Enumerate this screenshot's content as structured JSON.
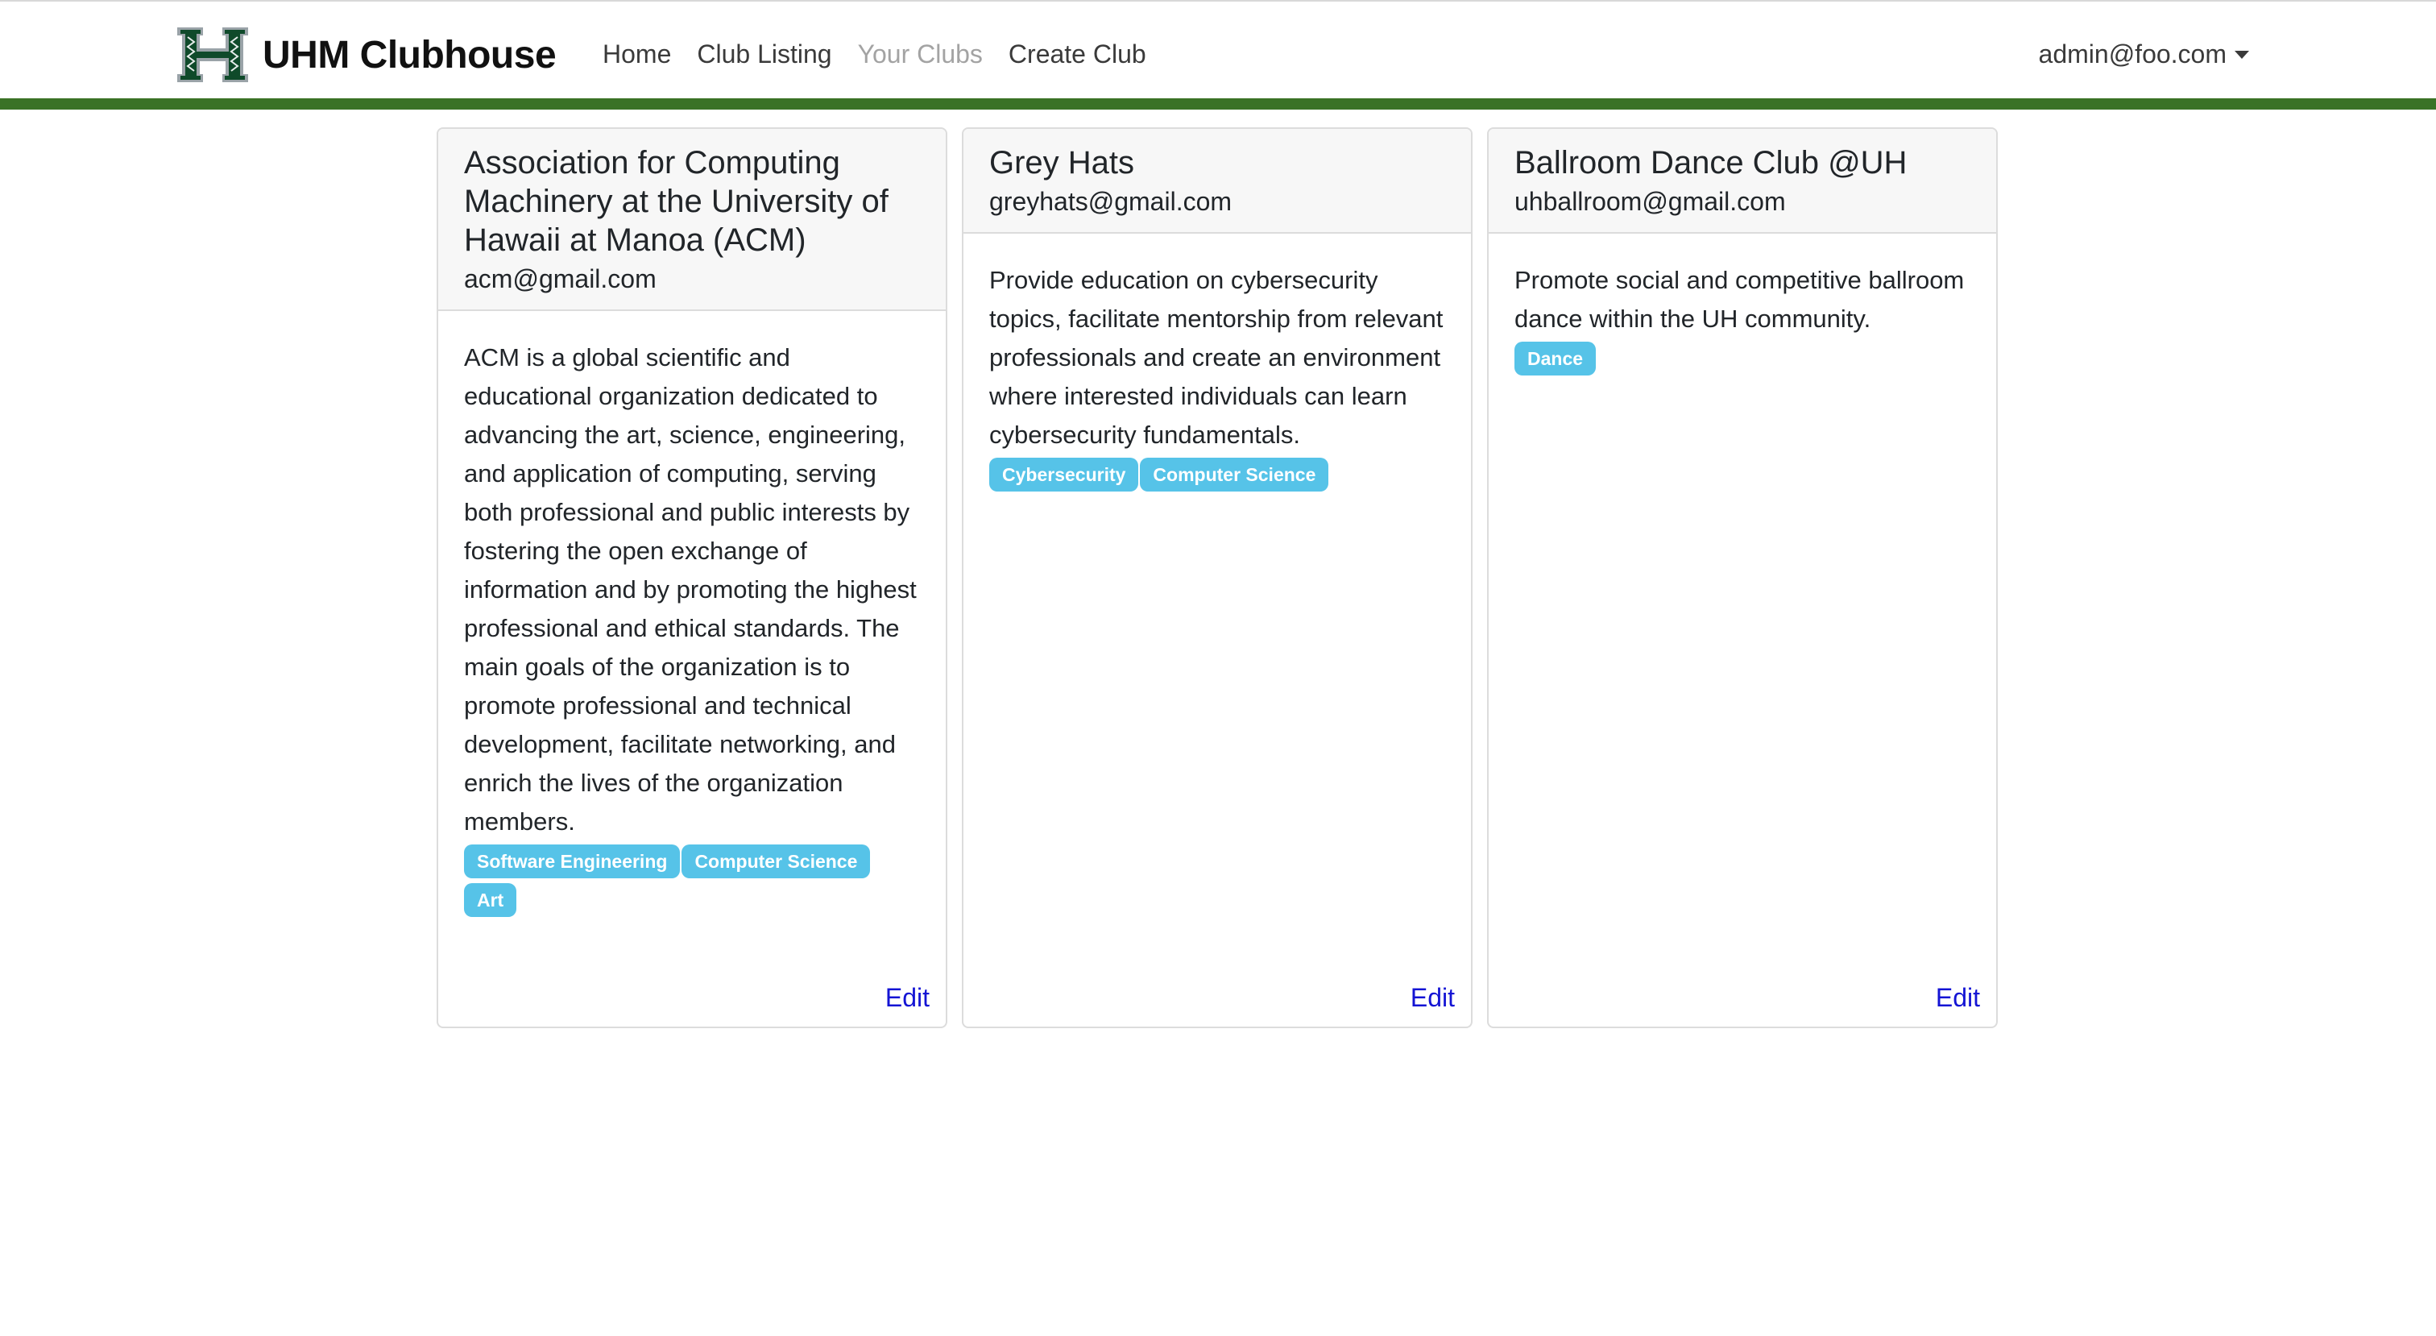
{
  "navbar": {
    "brand": "UHM Clubhouse",
    "links": [
      "Home",
      "Club Listing",
      "Your Clubs",
      "Create Club"
    ],
    "user": "admin@foo.com"
  },
  "colors": {
    "accent_bar": "#3a7226",
    "badge": "#56c3e8",
    "edit_link": "#1414d4",
    "muted_link": "#a3a3a3"
  },
  "clubs": [
    {
      "name": "Association for Computing Machinery at the University of Hawaii at Manoa (ACM)",
      "email": "acm@gmail.com",
      "description": "ACM is a global scientific and educational organization dedicated to advancing the art, science, engineering, and application of computing, serving both professional and public interests by fostering the open exchange of information and by promoting the highest professional and ethical standards. The main goals of the organization is to promote professional and technical development, facilitate networking, and enrich the lives of the organization members.",
      "tags": [
        "Software Engineering",
        "Computer Science",
        "Art"
      ],
      "edit": "Edit"
    },
    {
      "name": "Grey Hats",
      "email": "greyhats@gmail.com",
      "description": "Provide education on cybersecurity topics, facilitate mentorship from relevant professionals and create an environment where interested individuals can learn cybersecurity fundamentals.",
      "tags": [
        "Cybersecurity",
        "Computer Science"
      ],
      "edit": "Edit"
    },
    {
      "name": "Ballroom Dance Club @UH",
      "email": "uhballroom@gmail.com",
      "description": "Promote social and competitive ballroom dance within the UH community.",
      "tags": [
        "Dance"
      ],
      "edit": "Edit"
    }
  ]
}
